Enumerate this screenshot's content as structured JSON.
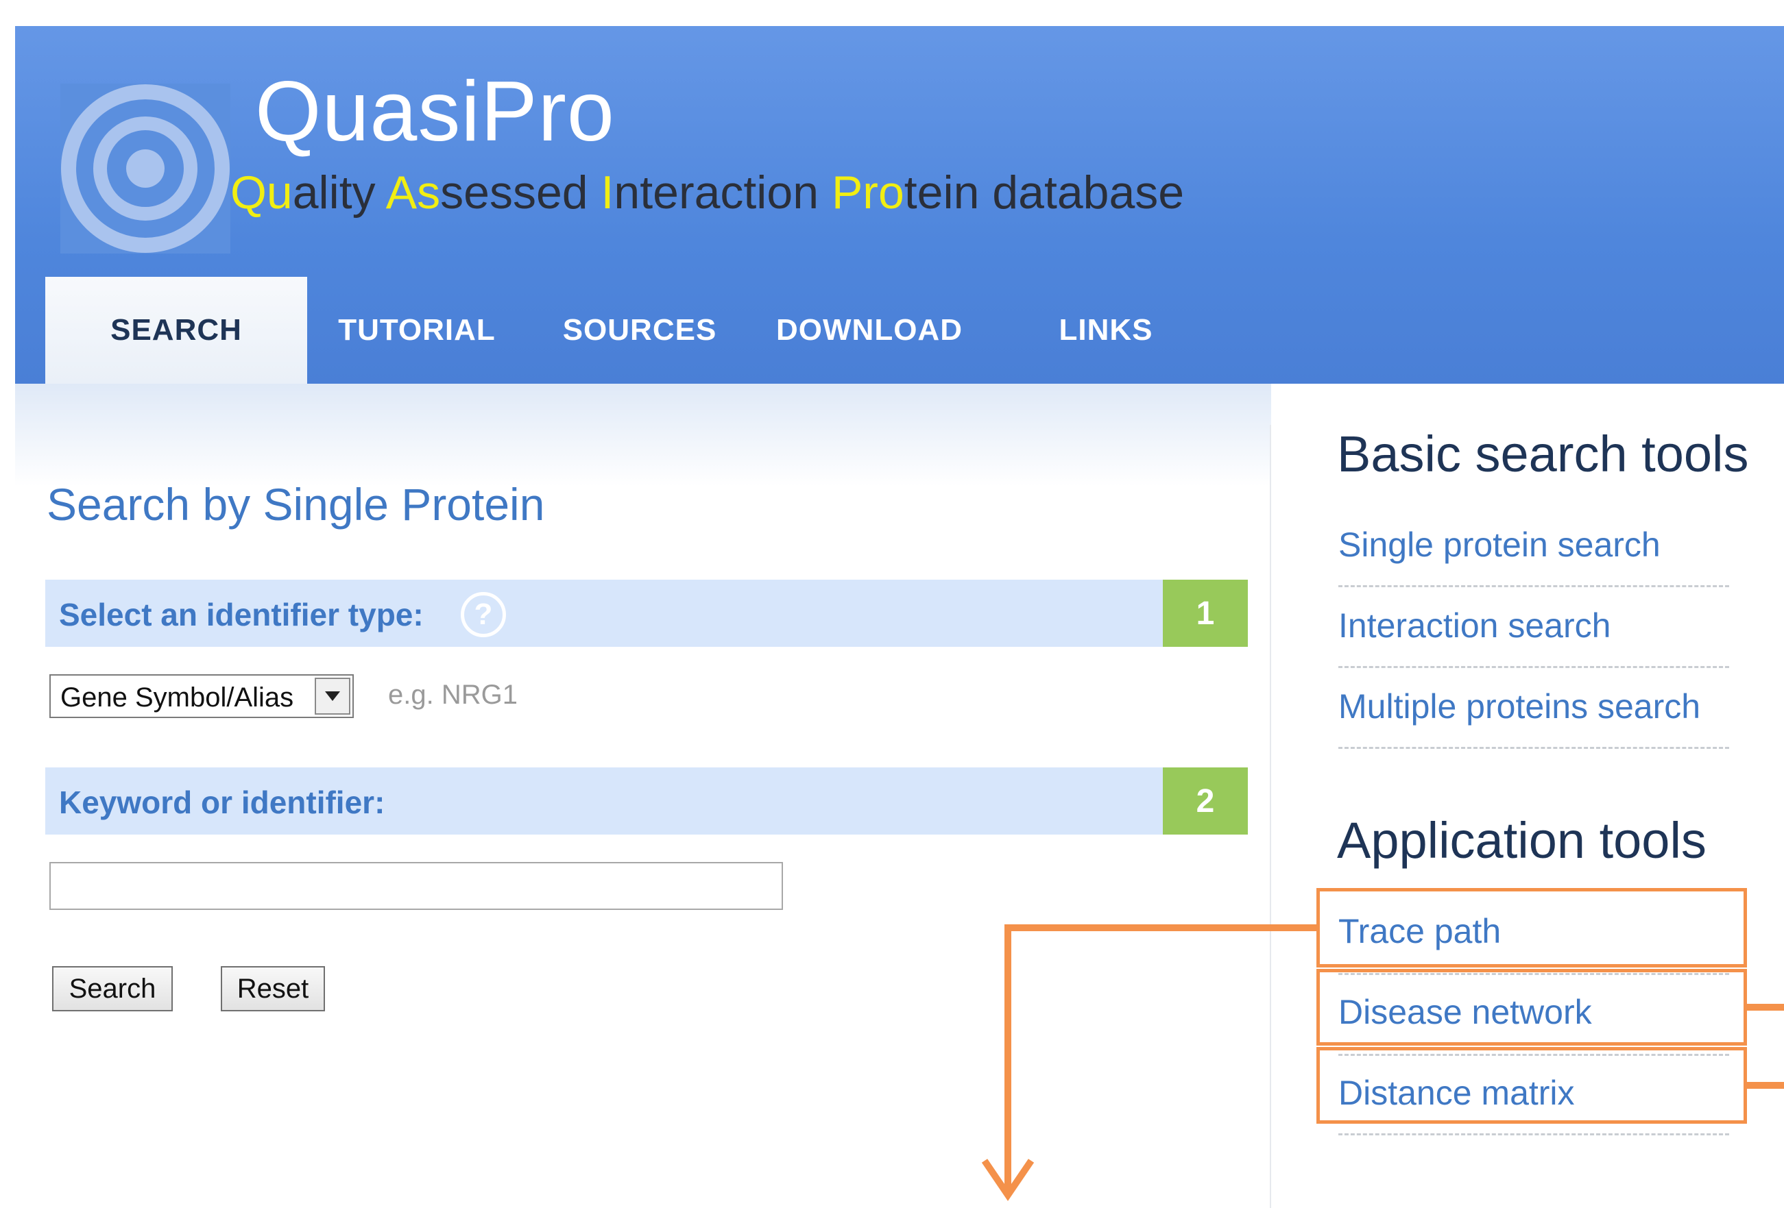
{
  "header": {
    "app_title": "QuasiPro",
    "subtitle_parts": [
      {
        "text": "Qu",
        "highlight": true
      },
      {
        "text": "ality ",
        "highlight": false
      },
      {
        "text": "As",
        "highlight": true
      },
      {
        "text": "sessed ",
        "highlight": false
      },
      {
        "text": "I",
        "highlight": true
      },
      {
        "text": "nteraction ",
        "highlight": false
      },
      {
        "text": "Pro",
        "highlight": true
      },
      {
        "text": "tein database",
        "highlight": false
      }
    ],
    "logo_icon": "concentric-rings-logo"
  },
  "nav": {
    "tabs": [
      {
        "label": "SEARCH",
        "active": true
      },
      {
        "label": "TUTORIAL",
        "active": false
      },
      {
        "label": "SOURCES",
        "active": false
      },
      {
        "label": "DOWNLOAD",
        "active": false
      },
      {
        "label": "LINKS",
        "active": false
      }
    ]
  },
  "main": {
    "title": "Search by Single Protein",
    "step1": {
      "label": "Select an identifier type:",
      "number": "1",
      "help_icon": "question-mark-icon",
      "select_value": "Gene Symbol/Alias",
      "example": "e.g. NRG1"
    },
    "step2": {
      "label": "Keyword or identifier:",
      "number": "2",
      "input_value": ""
    },
    "buttons": {
      "search": "Search",
      "reset": "Reset"
    }
  },
  "sidebar": {
    "basic_heading": "Basic search tools",
    "basic_links": [
      "Single protein search",
      "Interaction search",
      "Multiple proteins search"
    ],
    "app_heading": "Application tools",
    "app_links": [
      "Trace path",
      "Disease network",
      "Distance matrix"
    ]
  },
  "colors": {
    "header_blue": "#4f86dc",
    "link_blue": "#3f78c4",
    "step_bar": "#d7e6fb",
    "step_number": "#98c95a",
    "subtitle_highlight": "#f1ee12",
    "annotation_orange": "#f4914a"
  }
}
